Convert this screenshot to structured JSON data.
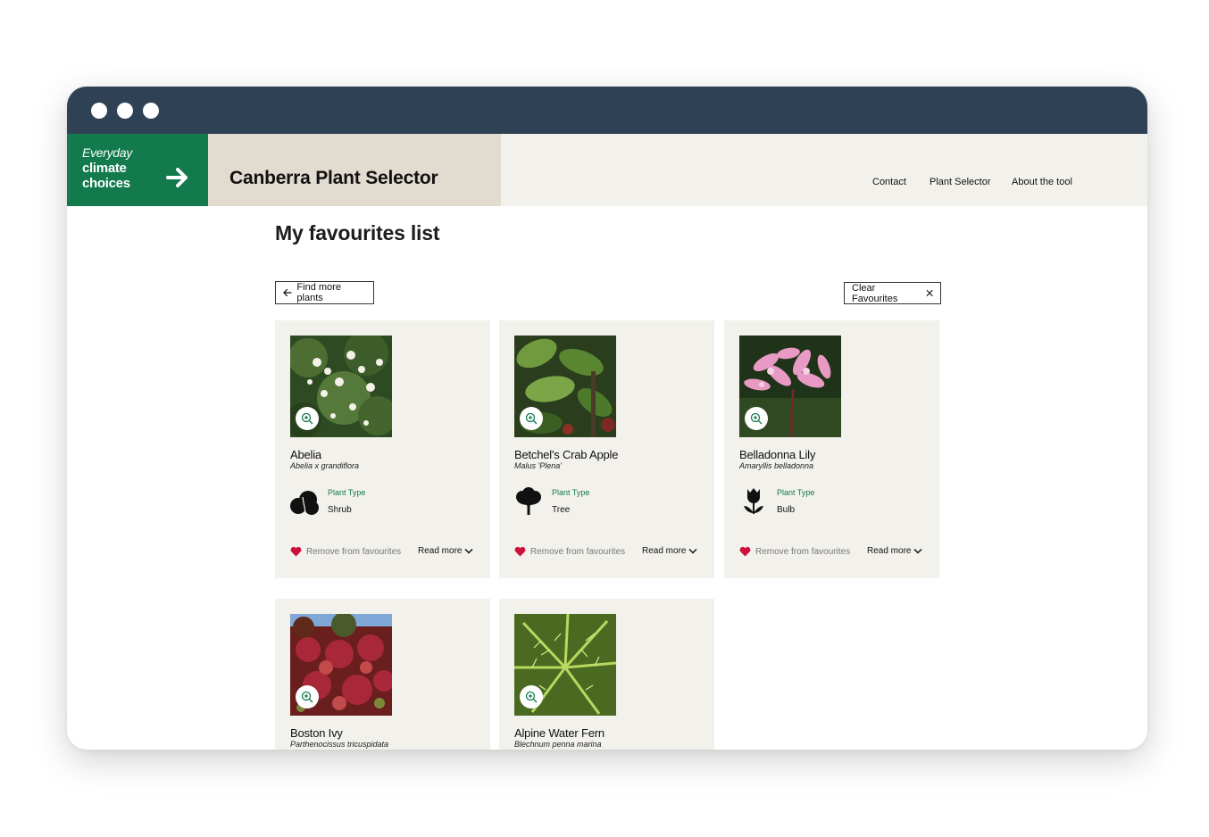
{
  "window": {
    "controls": [
      "close",
      "minimize",
      "maximize"
    ]
  },
  "brand": {
    "line1": "Everyday",
    "line2": "climate",
    "line3": "choices",
    "color": "#127a4d"
  },
  "header": {
    "title": "Canberra Plant Selector"
  },
  "nav": {
    "contact": "Contact",
    "plant_selector": "Plant Selector",
    "about": "About the tool"
  },
  "main": {
    "title": "My favourites list",
    "back_button": "Find more plants",
    "clear_button": "Clear Favourites"
  },
  "cards": [
    {
      "name": "Abelia",
      "scientific": "Abelia x grandiflora",
      "type_label": "Plant Type",
      "type": "Shrub",
      "type_icon": "shrub-icon",
      "remove": "Remove from favourites",
      "read_more": "Read more"
    },
    {
      "name": "Betchel's Crab Apple",
      "scientific": "Malus 'Plena'",
      "type_label": "Plant Type",
      "type": "Tree",
      "type_icon": "tree-icon",
      "remove": "Remove from favourites",
      "read_more": "Read more"
    },
    {
      "name": "Belladonna Lily",
      "scientific": "Amaryllis belladonna",
      "type_label": "Plant Type",
      "type": "Bulb",
      "type_icon": "bulb-icon",
      "remove": "Remove from favourites",
      "read_more": "Read more"
    },
    {
      "name": "Boston Ivy",
      "scientific": "Parthenocissus tricuspidata"
    },
    {
      "name": "Alpine Water Fern",
      "scientific": "Blechnum penna marina"
    }
  ],
  "colors": {
    "titlebar": "#2f4255",
    "accent_green": "#127a4d",
    "heart": "#d0103a",
    "card_bg": "#f2f1ec"
  }
}
